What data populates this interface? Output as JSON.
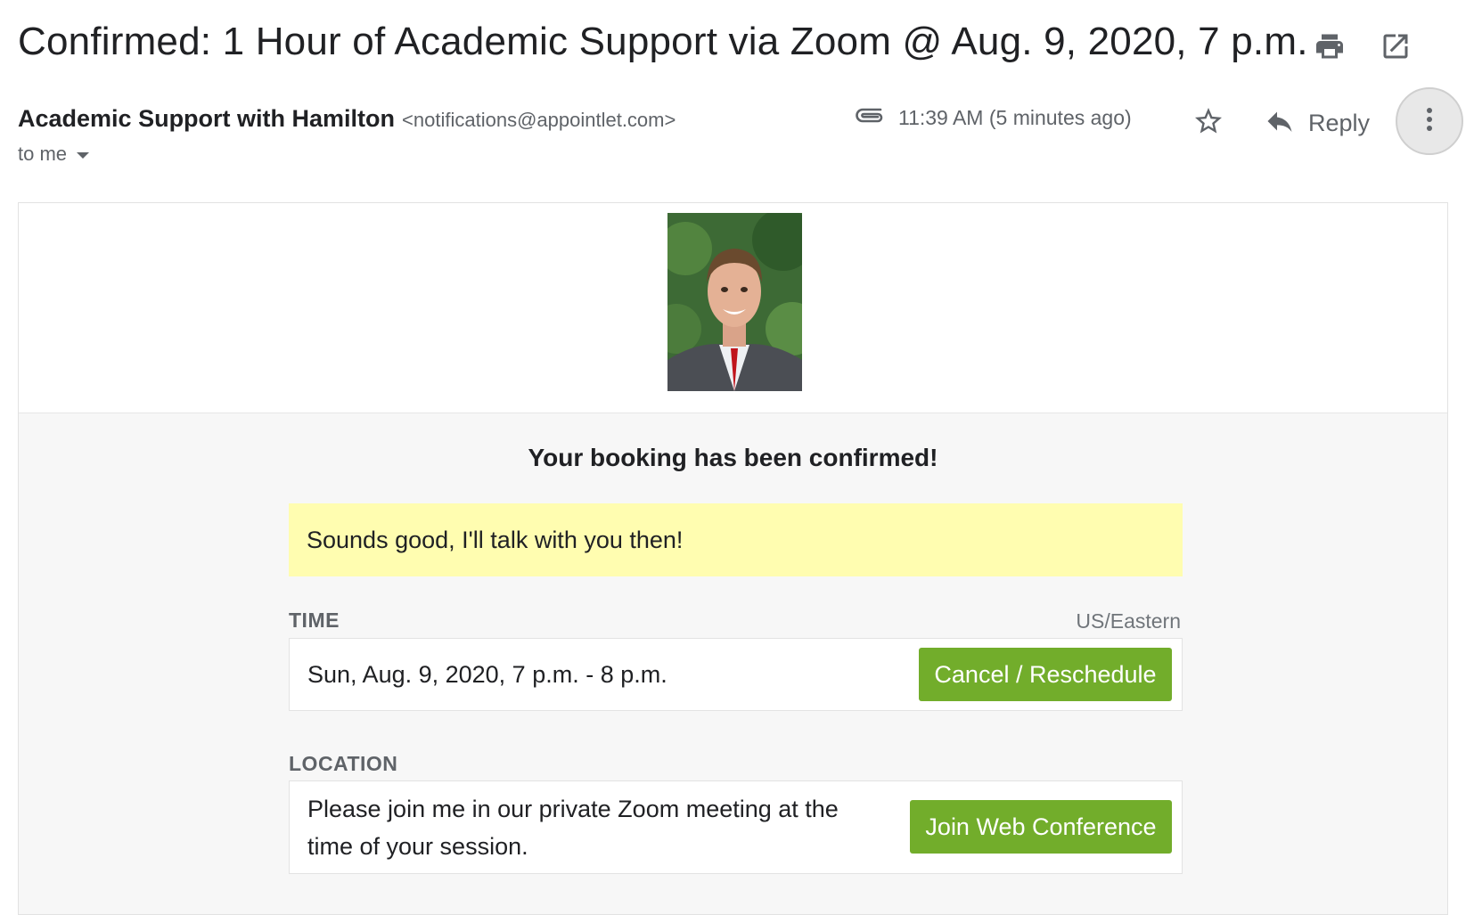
{
  "email": {
    "subject": "Confirmed: 1 Hour of Academic Support via Zoom @ Aug. 9, 2020, 7 p.m.",
    "sender_name": "Academic Support with Hamilton",
    "sender_email": "<notifications@appointlet.com>",
    "recipient": "to me",
    "timestamp": "11:39 AM (5 minutes ago)",
    "reply_label": "Reply"
  },
  "icons": {
    "print": "print-icon",
    "open_new": "open-in-new-icon",
    "attachment": "paperclip-icon",
    "star": "star-icon",
    "reply": "reply-icon",
    "more": "more-vertical-icon",
    "dropdown": "caret-down-icon"
  },
  "body": {
    "headline": "Your booking has been confirmed!",
    "note": "Sounds good, I'll talk with you then!",
    "time_label": "TIME",
    "timezone": "US/Eastern",
    "time_value": "Sun, Aug. 9, 2020, 7 p.m. - 8 p.m.",
    "cancel_button": "Cancel / Reschedule",
    "location_label": "LOCATION",
    "location_line1": "Please join me in our private Zoom meeting at the",
    "location_line2": "time of your session.",
    "join_button": "Join Web Conference"
  },
  "colors": {
    "accent_green": "#72ad2b",
    "note_yellow": "#fffdb0"
  }
}
